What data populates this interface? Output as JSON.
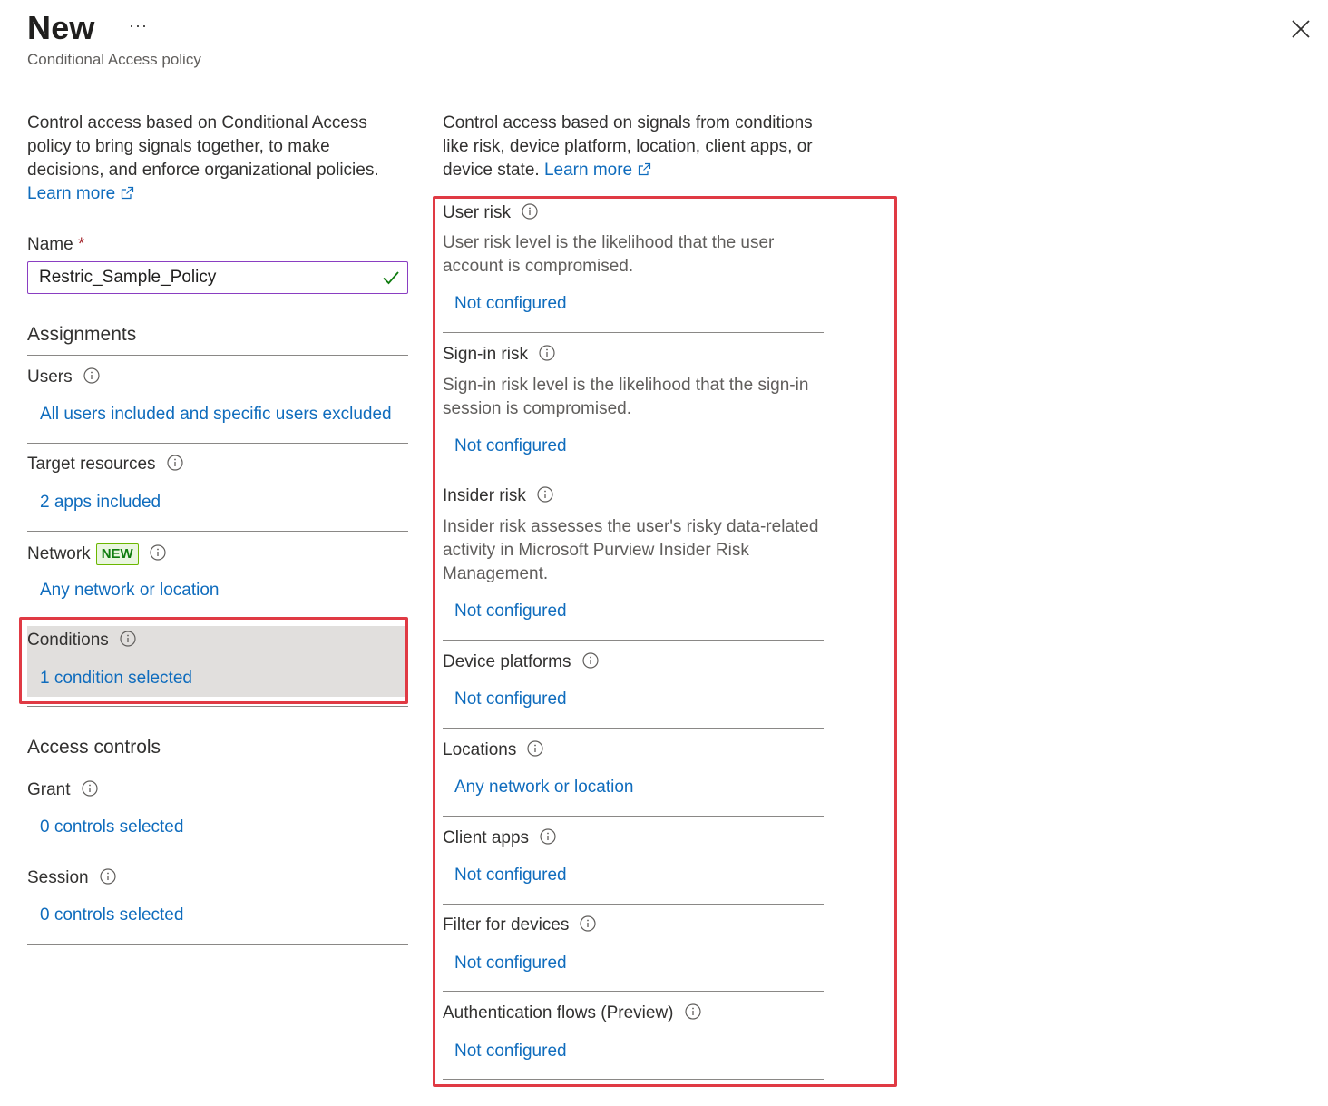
{
  "header": {
    "title": "New",
    "more": "···",
    "subtitle": "Conditional Access policy"
  },
  "left": {
    "intro": "Control access based on Conditional Access policy to bring signals together, to make decisions, and enforce organizational policies.",
    "learn_more": "Learn more",
    "name_label": "Name",
    "name_required": "*",
    "name_value": "Restric_Sample_Policy",
    "assignments_header": "Assignments",
    "users_label": "Users",
    "users_value": "All users included and specific users excluded",
    "target_label": "Target resources",
    "target_value": "2 apps included",
    "network_label": "Network",
    "network_badge": "NEW",
    "network_value": "Any network or location",
    "conditions_label": "Conditions",
    "conditions_value": "1 condition selected",
    "access_header": "Access controls",
    "grant_label": "Grant",
    "grant_value": "0 controls selected",
    "session_label": "Session",
    "session_value": "0 controls selected"
  },
  "right": {
    "intro": "Control access based on signals from conditions like risk, device platform, location, client apps, or device state.",
    "learn_more": "Learn more",
    "user_risk": {
      "label": "User risk",
      "desc": "User risk level is the likelihood that the user account is compromised.",
      "value": "Not configured"
    },
    "signin_risk": {
      "label": "Sign-in risk",
      "desc": "Sign-in risk level is the likelihood that the sign-in session is compromised.",
      "value": "Not configured"
    },
    "insider_risk": {
      "label": "Insider risk",
      "desc": "Insider risk assesses the user's risky data-related activity in Microsoft Purview Insider Risk Management.",
      "value": "Not configured"
    },
    "device_platforms": {
      "label": "Device platforms",
      "value": "Not configured"
    },
    "locations": {
      "label": "Locations",
      "value": "Any network or location"
    },
    "client_apps": {
      "label": "Client apps",
      "value": "Not configured"
    },
    "filter_devices": {
      "label": "Filter for devices",
      "value": "Not configured"
    },
    "auth_flows": {
      "label": "Authentication flows (Preview)",
      "value": "Not configured"
    }
  },
  "colors": {
    "link": "#0f6cbd",
    "highlight_border": "#e03a44",
    "selected_bg": "#e1dfdd",
    "input_border": "#8a3ec2",
    "valid_check": "#107c10"
  },
  "icons": [
    "more-icon",
    "close-icon",
    "external-link-icon",
    "checkmark-icon",
    "info-icon"
  ]
}
